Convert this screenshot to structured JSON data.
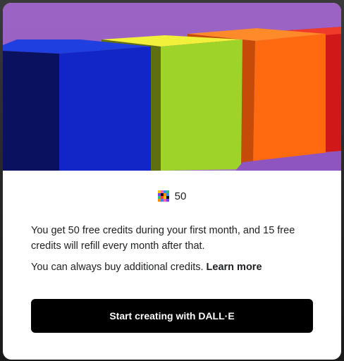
{
  "hero": {
    "image": "colorful-blocks-illustration"
  },
  "credits": {
    "icon": "credits-pixel-icon",
    "count": "50"
  },
  "body": {
    "paragraph1": "You get 50 free credits during your first month, and 15 free credits will refill every month after that.",
    "paragraph2_text": "You can always buy additional credits. ",
    "learn_more_label": "Learn more"
  },
  "cta": {
    "label": "Start creating with DALL·E"
  },
  "colors": {
    "button_bg": "#000000",
    "modal_bg": "#ffffff",
    "hero_bg": "#9b63c4"
  }
}
